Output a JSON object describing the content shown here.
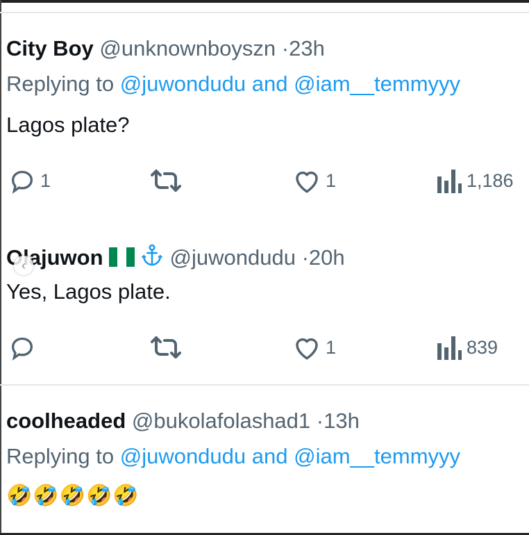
{
  "tweets": [
    {
      "name": "City Boy",
      "handle": "@unknownboyszn",
      "separator": "·",
      "time": "23h",
      "replying_prefix": "Replying to ",
      "replying_user1": "@juwondudu",
      "replying_and": " and ",
      "replying_user2": "@iam__temmyyy",
      "text": "Lagos plate?",
      "replies": "1",
      "likes": "1",
      "views": "1,186"
    },
    {
      "name": "Olajuwon",
      "handle": "@juwondudu",
      "separator": "·",
      "time": "20h",
      "text": "Yes, Lagos plate.",
      "likes": "1",
      "views": "839"
    },
    {
      "name": "coolheaded",
      "handle": "@bukolafolashad1",
      "separator": "·",
      "time": "13h",
      "replying_prefix": "Replying to ",
      "replying_user1": "@juwondudu",
      "replying_and": " and ",
      "replying_user2": "@iam__temmyyy",
      "text": "🤣🤣🤣🤣🤣"
    }
  ],
  "colors": {
    "link": "#1d9bf0",
    "secondary": "#536471",
    "primary": "#0f1419",
    "flag_green": "#008751",
    "flag_white": "#ffffff"
  },
  "icons": [
    "reply-icon",
    "retweet-icon",
    "like-icon",
    "views-icon",
    "anchor-icon",
    "nigeria-flag-icon",
    "carousel-prev-icon"
  ]
}
